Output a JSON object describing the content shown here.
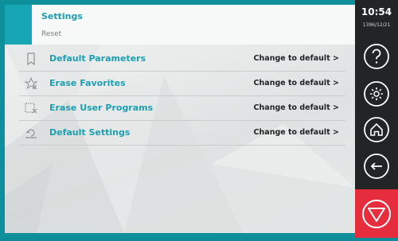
{
  "header": {
    "title": "Settings",
    "subtitle": "Reset"
  },
  "rows": [
    {
      "label": "Default Parameters",
      "action": "Change to default  >",
      "icon": "bookmark-icon"
    },
    {
      "label": "Erase Favorites",
      "action": "Change to default  >",
      "icon": "erase-star-icon"
    },
    {
      "label": "Erase User Programs",
      "action": "Change to default  >",
      "icon": "erase-programs-icon"
    },
    {
      "label": "Default Settings",
      "action": "Change to default  >",
      "icon": "reset-settings-icon"
    }
  ],
  "sidebar": {
    "time": "10:54",
    "date": "1396/12/21",
    "buttons": [
      "help-icon",
      "gear-icon",
      "home-icon",
      "back-icon"
    ],
    "stop": "stop-icon"
  },
  "colors": {
    "accent": "#17a6b4",
    "text_accent": "#1d9fb0",
    "sidebar": "#222425",
    "stop": "#e62d3e"
  }
}
